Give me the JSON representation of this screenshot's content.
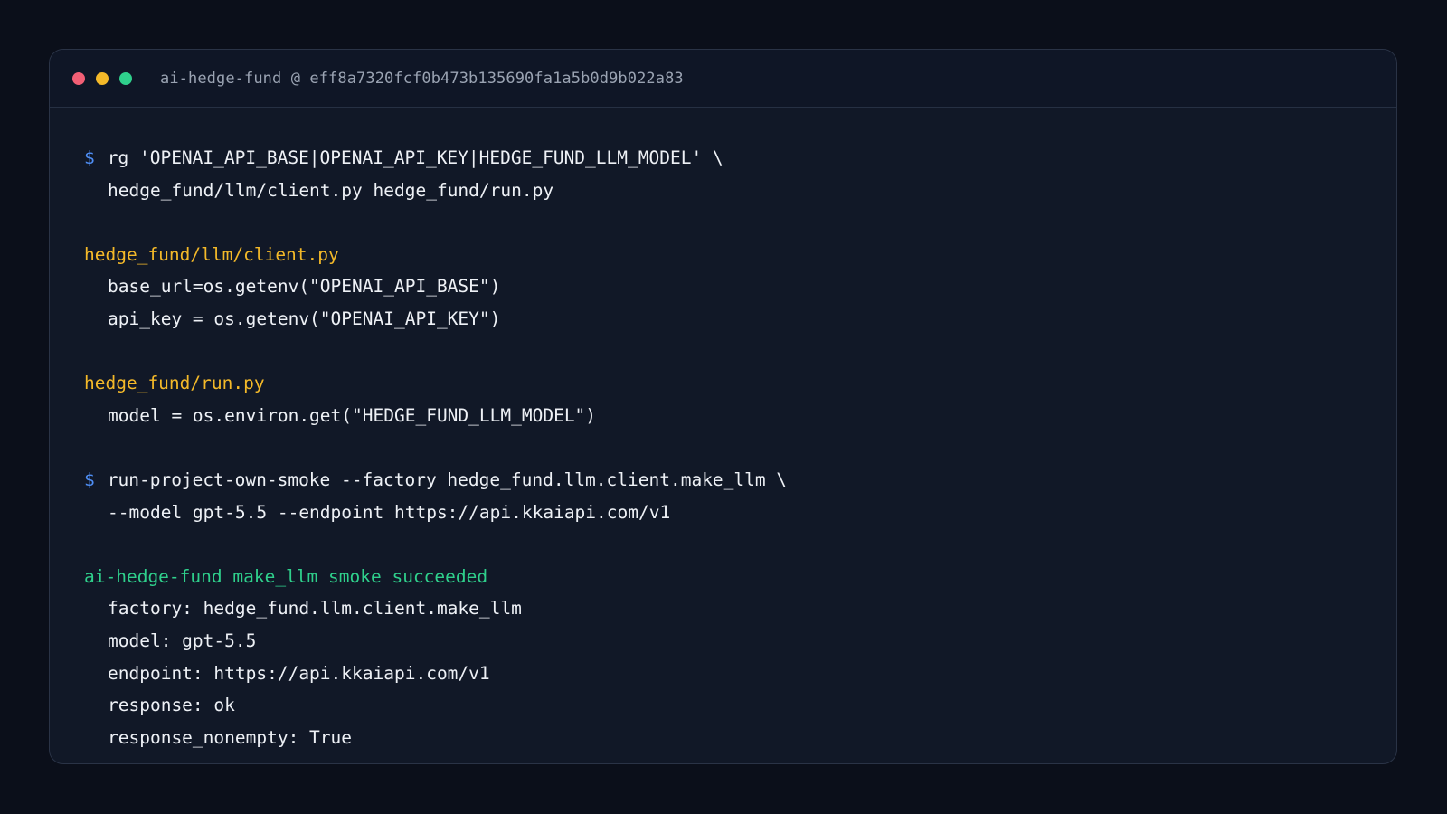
{
  "window": {
    "title": "ai-hedge-fund @ eff8a7320fcf0b473b135690fa1a5b0d9b022a83"
  },
  "colors": {
    "background": "#0b0f1a",
    "terminal_bg": "#111827",
    "prompt": "#4f8ff7",
    "file_header": "#f4b929",
    "success": "#2fd08c",
    "text": "#eef1f6",
    "title_text": "#9aa3b2"
  },
  "commands": [
    {
      "prompt": "$",
      "line1": "rg 'OPENAI_API_BASE|OPENAI_API_KEY|HEDGE_FUND_LLM_MODEL' \\",
      "line2": "hedge_fund/llm/client.py hedge_fund/run.py"
    },
    {
      "prompt": "$",
      "line1": "run-project-own-smoke --factory hedge_fund.llm.client.make_llm \\",
      "line2": "--model gpt-5.5 --endpoint https://api.kkaiapi.com/v1"
    }
  ],
  "matches": [
    {
      "file": "hedge_fund/llm/client.py",
      "lines": [
        "base_url=os.getenv(\"OPENAI_API_BASE\")",
        "api_key = os.getenv(\"OPENAI_API_KEY\")"
      ]
    },
    {
      "file": "hedge_fund/run.py",
      "lines": [
        "model = os.environ.get(\"HEDGE_FUND_LLM_MODEL\")"
      ]
    }
  ],
  "result": {
    "header": "ai-hedge-fund make_llm smoke succeeded",
    "lines": [
      "factory: hedge_fund.llm.client.make_llm",
      "model: gpt-5.5",
      "endpoint: https://api.kkaiapi.com/v1",
      "response: ok",
      "response_nonempty: True"
    ]
  }
}
